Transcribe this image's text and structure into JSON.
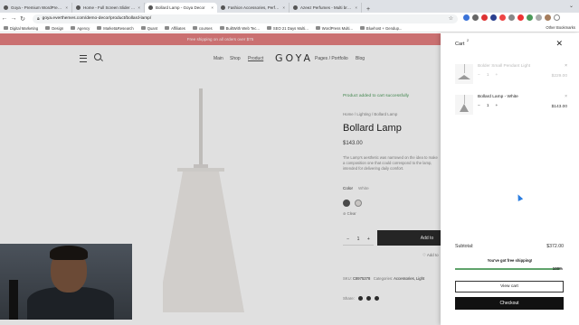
{
  "browser": {
    "tabs": [
      {
        "label": "Goya - Premium WordPress Th",
        "active": false
      },
      {
        "label": "Home - Full Screen Slider - G",
        "active": false
      },
      {
        "label": "Bollard Lamp - Goya Decor",
        "active": true
      },
      {
        "label": "Fashion Accessories, Perfume",
        "active": false
      },
      {
        "label": "Azeez Perfumes - Multi brand",
        "active": false
      }
    ],
    "new_tab": "+",
    "url": "goya.everthemes.com/demo-decor/product/bollard-lamp/",
    "bookmarks": [
      "Digital Marketing",
      "Design",
      "Agency",
      "Market&Research",
      "Quant",
      "Affiliates",
      "courses",
      "BuiltWith Web Tec...",
      "SEO 21 Days Multi...",
      "WordPress Multi...",
      "Bluehost + Gendup..."
    ],
    "other_bookmarks": "Other Bookmarks"
  },
  "site": {
    "promo": "Free shipping on all orders over $75",
    "nav": [
      "Main",
      "Shop",
      "Product"
    ],
    "nav_right": [
      "Pages / Portfolio",
      "Blog"
    ],
    "logo": "GOYA",
    "notice": "Product added to cart successfully",
    "breadcrumb": "Home / Lighting / Bollard Lamp",
    "product_title": "Bollard Lamp",
    "price": "$143.00",
    "description": "The Lamp's aesthetic was narrowed on the idea to make a\ncomposition one that could correspond to the lamp, intended\nfor delivering daily comfort.",
    "color_label": "Color",
    "color_value": "White",
    "clear": "⊘ Clear",
    "qty_minus": "−",
    "qty_value": "1",
    "qty_plus": "+",
    "add_to_cart": "Add to",
    "wishlist": "♡ Add to",
    "meta_sku_label": "SKU:",
    "meta_sku": "C8975378",
    "meta_cat_label": "Categories:",
    "meta_cats": "Accessories, Light",
    "share_label": "Share:"
  },
  "cart": {
    "title": "Cart",
    "count": "2",
    "close": "✕",
    "items": [
      {
        "name": "Bolder Small Pendant Light",
        "qty": "1",
        "price": "$229.00",
        "faded": true
      },
      {
        "name": "Bollard Lamp - White",
        "qty": "1",
        "price": "$143.00",
        "faded": false
      }
    ],
    "minus": "−",
    "plus": "+",
    "remove": "×",
    "subtotal_label": "Subtotal:",
    "subtotal_value": "$372.00",
    "free_shipping": "You've got free shipping!",
    "progress_label": "100%",
    "progress_fraction": 1.0,
    "view_cart": "View cart",
    "checkout": "Checkout"
  },
  "colors": {
    "promo_bg": "#e68081",
    "progress": "#5fa36b",
    "swatch_dark": "#555555",
    "swatch_light": "#e4e1de"
  }
}
